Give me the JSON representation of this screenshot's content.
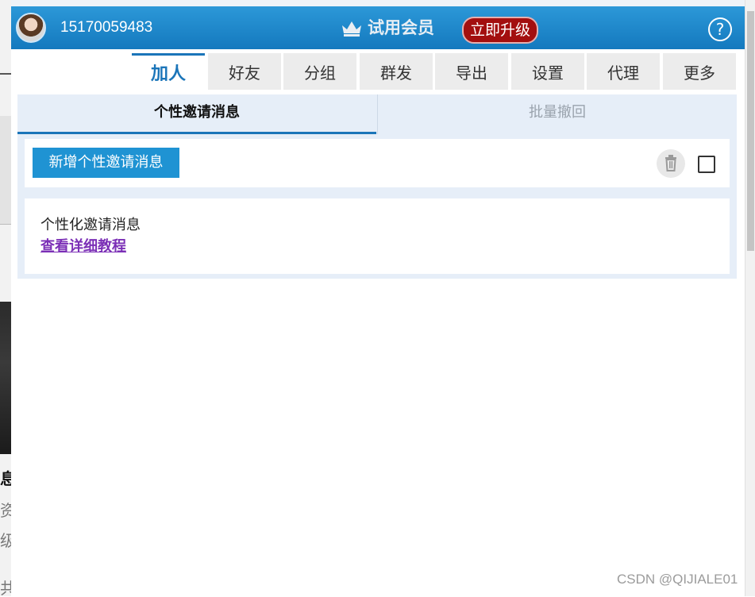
{
  "header": {
    "phone": "15170059483",
    "trial_label": "试用会员",
    "upgrade_label": "立即升级",
    "help_symbol": "?",
    "bg_color": "#1a86c8"
  },
  "tabs": [
    {
      "label": "加人",
      "active": true
    },
    {
      "label": "好友"
    },
    {
      "label": "分组"
    },
    {
      "label": "群发"
    },
    {
      "label": "导出"
    },
    {
      "label": "设置"
    },
    {
      "label": "代理"
    },
    {
      "label": "更多"
    }
  ],
  "subtabs": {
    "personal": "个性邀请消息",
    "batch_revoke": "批量撤回"
  },
  "toolbar": {
    "add_button": "新增个性邀请消息"
  },
  "info": {
    "title": "个性化邀请消息",
    "link": "查看详细教程"
  },
  "background_page": {
    "glyphs": [
      "息",
      "资",
      "级",
      "共"
    ]
  },
  "watermark": "CSDN @QIJIALE01",
  "colors": {
    "accent": "#1b75b9",
    "upgrade": "#a30f0f",
    "link": "#7b2fb6"
  }
}
